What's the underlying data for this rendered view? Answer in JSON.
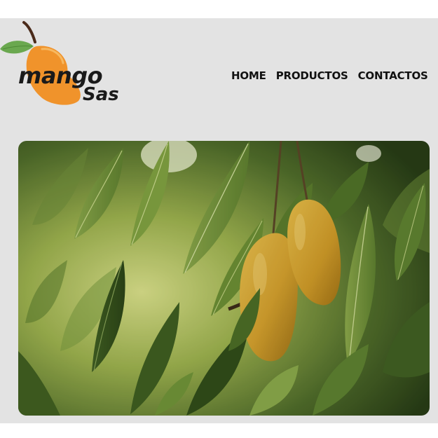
{
  "brand": {
    "word1": "mango",
    "word2": "Sas",
    "logo_icon": "mango-fruit-icon",
    "colors": {
      "mango_orange": "#f0932b",
      "leaf_green": "#6aa84f",
      "stem_brown": "#4a2a1a",
      "text_dark": "#1a1a1a"
    }
  },
  "nav": {
    "items": [
      {
        "label": "HOME"
      },
      {
        "label": "PRODUCTOS"
      },
      {
        "label": "CONTACTOS"
      }
    ]
  },
  "hero": {
    "icon": "mango-tree-photo",
    "colors": {
      "foliage_dark": "#2f4a1c",
      "foliage_light": "#b7c76a",
      "fruit": "#d9a531"
    }
  },
  "colors": {
    "panel_bg": "#e3e3e3",
    "page_bg": "#ffffff"
  }
}
